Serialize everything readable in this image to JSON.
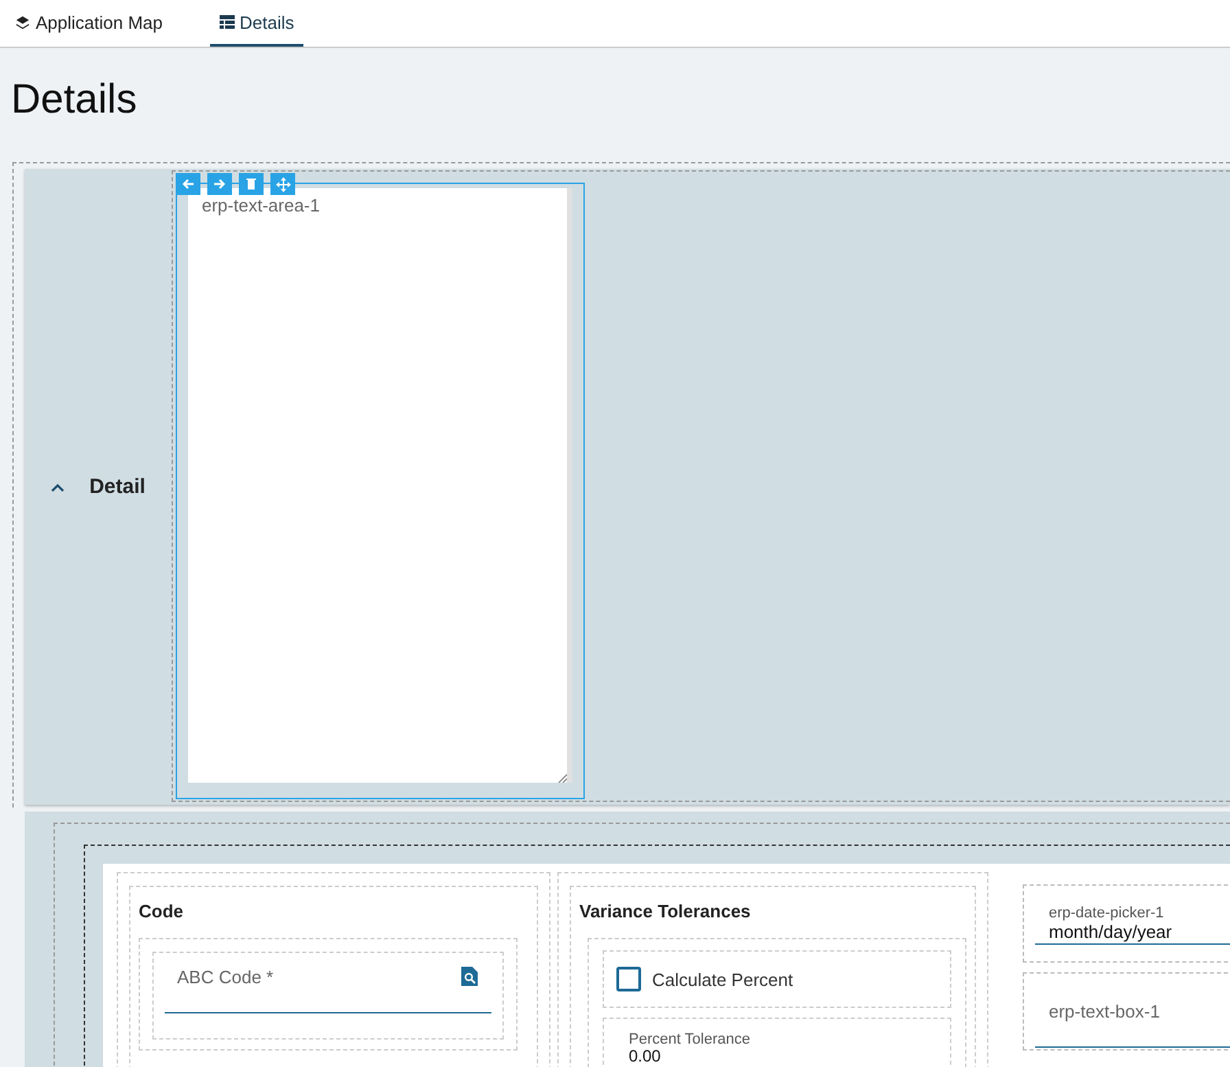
{
  "tabs": [
    {
      "label": "Application Map",
      "selected": false
    },
    {
      "label": "Details",
      "selected": true
    }
  ],
  "page_title": "Details",
  "detail_section": {
    "title": "Detail",
    "expanded": true,
    "text_area": {
      "label": "erp-text-area-1",
      "selected": true
    }
  },
  "form": {
    "code_card": {
      "title": "Code",
      "field": {
        "placeholder": "ABC Code *"
      }
    },
    "variance_card": {
      "title": "Variance Tolerances",
      "checkbox": {
        "label": "Calculate Percent",
        "checked": false
      },
      "field": {
        "label": "Percent Tolerance",
        "value": "0.00"
      }
    },
    "right_fields": [
      {
        "kind": "date",
        "label": "erp-date-picker-1",
        "value": "month/day/year"
      },
      {
        "kind": "text",
        "placeholder": "erp-text-box-1"
      }
    ]
  }
}
